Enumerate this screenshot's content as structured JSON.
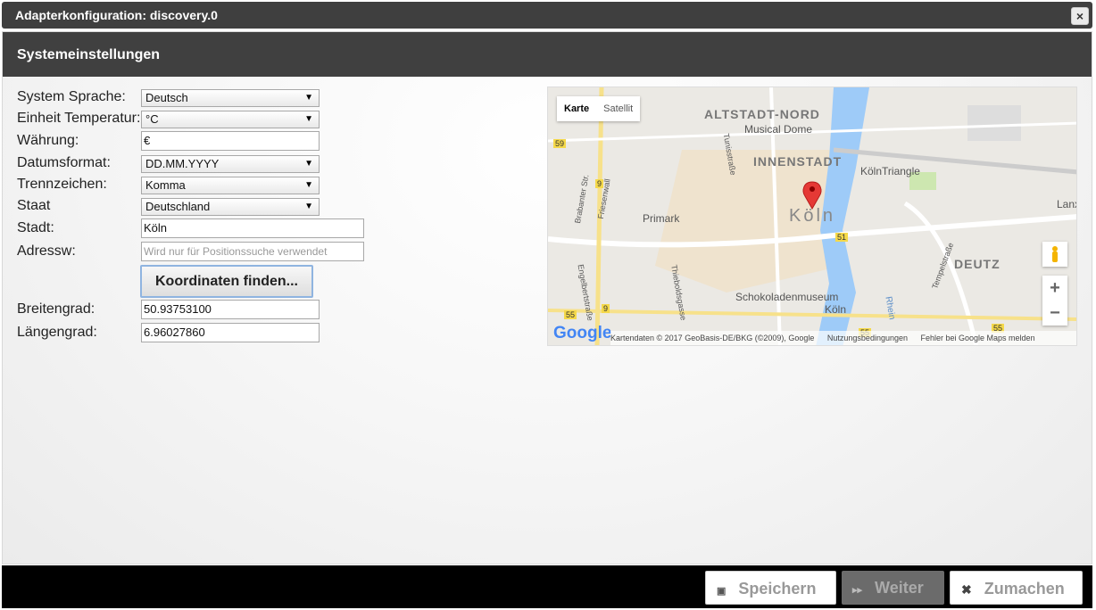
{
  "window": {
    "title": "Adapterkonfiguration: discovery.0",
    "close_label": "×"
  },
  "section": {
    "title": "Systemeinstellungen"
  },
  "form": {
    "language": {
      "label": "System Sprache:",
      "value": "Deutsch"
    },
    "temp_unit": {
      "label": "Einheit Temperatur:",
      "value": "°C"
    },
    "currency": {
      "label": "Währung:",
      "value": "€"
    },
    "date_format": {
      "label": "Datumsformat:",
      "value": "DD.MM.YYYY"
    },
    "separator": {
      "label": "Trennzeichen:",
      "value": "Komma"
    },
    "country": {
      "label": "Staat",
      "value": "Deutschland"
    },
    "city": {
      "label": "Stadt:",
      "value": "Köln"
    },
    "address": {
      "label": "Adressw:",
      "placeholder": "Wird nur für Positionssuche verwendet"
    },
    "find_button": "Koordinaten finden...",
    "latitude": {
      "label": "Breitengrad:",
      "value": "50.93753100"
    },
    "longitude": {
      "label": "Längengrad:",
      "value": "6.96027860"
    }
  },
  "map": {
    "type_map": "Karte",
    "type_satellite": "Satellit",
    "zoom_in": "+",
    "zoom_out": "−",
    "labels": {
      "altstadt": "ALTSTADT-NORD",
      "innenstadt": "INNENSTADT",
      "koeln": "Köln",
      "deutz": "DEUTZ",
      "musical_dome": "Musical Dome",
      "koeln_triangle": "KölnTriangle",
      "primark": "Primark",
      "schokoladenmuseum": "Schokoladenmuseum",
      "schoko_koeln": "Köln",
      "lanx": "Lanx",
      "rhein": "Rhein",
      "tunisstrasse": "Tunisstraße",
      "friesenwall": "Friesenwall",
      "brabanter": "Brabanter Str.",
      "engelbert": "Engelbertstraße",
      "thieboldsgasse": "Thieboldsgasse",
      "tempelstrasse": "Tempelstraße"
    },
    "road_numbers": {
      "r59": "59",
      "r9a": "9",
      "r9b": "9",
      "r51": "51",
      "r55a": "55",
      "r55b": "55",
      "r55c": "55"
    },
    "google": "Google",
    "attribution": "Kartendaten © 2017 GeoBasis-DE/BKG (©2009), Google",
    "terms": "Nutzungsbedingungen",
    "report": "Fehler bei Google Maps melden"
  },
  "footer": {
    "save": "Speichern",
    "next": "Weiter",
    "close": "Zumachen"
  },
  "colors": {
    "accent": "#8fb4e0",
    "header": "#404040",
    "marker": "#e53935",
    "river": "#9ecbf8"
  }
}
